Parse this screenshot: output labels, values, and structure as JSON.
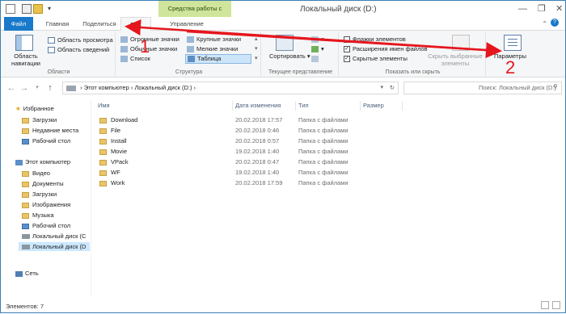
{
  "titlebar": {
    "contextual_tab": "Средства работы с дисками",
    "window_title": "Локальный диск (D:)",
    "controls": [
      "—",
      "❐",
      "✕"
    ]
  },
  "tabs": [
    {
      "label": "Файл"
    },
    {
      "label": "Главная"
    },
    {
      "label": "Поделиться"
    },
    {
      "label": "Вид"
    },
    {
      "label": "Управление"
    }
  ],
  "ribbon": {
    "panes": {
      "nav_pane": "Область навигации",
      "preview": "Область просмотра",
      "details": "Область сведений",
      "group_label": "Области"
    },
    "layout": {
      "items": [
        "Огромные значки",
        "Крупные значки",
        "Обычные значки",
        "Мелкие значки",
        "Список",
        "Таблица"
      ],
      "group_label": "Структура"
    },
    "current_view": {
      "sort": "Сортировать",
      "group_label": "Текущее представление"
    },
    "show_hide": {
      "item_checkboxes": "Флажки элементов",
      "extensions": "Расширения имен файлов",
      "hidden": "Скрытые элементы",
      "hide_selected": "Скрыть выбранные элементы",
      "group_label": "Показать или скрыть"
    },
    "options": {
      "label": "Параметры"
    }
  },
  "address": {
    "path": [
      "Этот компьютер",
      "Локальный диск (D:)"
    ],
    "search_placeholder": "Поиск: Локальный диск (D:)"
  },
  "nav": {
    "favorites": "Избранное",
    "fav_items": [
      "Загрузки",
      "Недавние места",
      "Рабочий стол"
    ],
    "computer": "Этот компьютер",
    "pc_items": [
      "Видео",
      "Документы",
      "Загрузки",
      "Изображения",
      "Музыка",
      "Рабочий стол",
      "Локальный диск (C",
      "Локальный диск (D"
    ],
    "network": "Сеть"
  },
  "columns": [
    "Имя",
    "Дата изменения",
    "Тип",
    "Размер"
  ],
  "files": [
    {
      "name": "Download",
      "date": "20.02.2018 17:57",
      "type": "Папка с файлами"
    },
    {
      "name": "File",
      "date": "20.02.2018 0:46",
      "type": "Папка с файлами"
    },
    {
      "name": "Install",
      "date": "20.02.2018 0:57",
      "type": "Папка с файлами"
    },
    {
      "name": "Movie",
      "date": "19.02.2018 1:40",
      "type": "Папка с файлами"
    },
    {
      "name": "VPack",
      "date": "20.02.2018 0:47",
      "type": "Папка с файлами"
    },
    {
      "name": "WF",
      "date": "19.02.2018 1:40",
      "type": "Папка с файлами"
    },
    {
      "name": "Work",
      "date": "20.02.2018 17:59",
      "type": "Папка с файлами"
    }
  ],
  "status": "Элементов: 7",
  "annotations": {
    "one": "1",
    "two": "2"
  },
  "colors": {
    "accent": "#1979ca",
    "annotation": "#e5161d",
    "folder": "#e9c569",
    "contextual": "#cfe59b"
  }
}
